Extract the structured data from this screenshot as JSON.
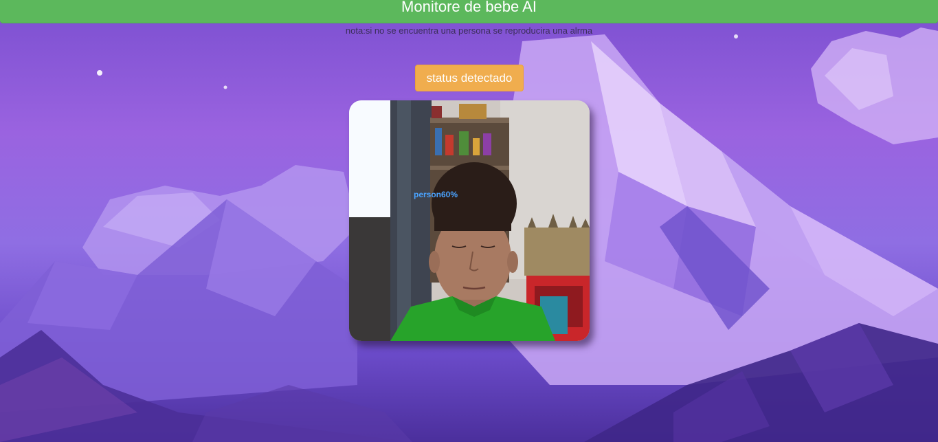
{
  "header": {
    "title": "Monitore de bebe AI"
  },
  "note": {
    "text": "nota:si no se encuentra una persona se reproducira una alrma"
  },
  "status_button": {
    "label": "status detectado"
  },
  "video": {
    "detection_label": "person60%"
  },
  "colors": {
    "header": "#5cb85c",
    "status_button": "#f0ad4e",
    "detection_label": "#4aa3ff"
  }
}
